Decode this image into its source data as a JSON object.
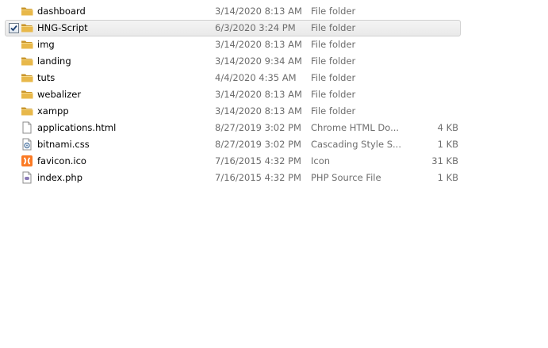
{
  "files": [
    {
      "name": "dashboard",
      "date": "3/14/2020 8:13 AM",
      "type": "File folder",
      "size": "",
      "icon": "folder-icon",
      "selected": false
    },
    {
      "name": "HNG-Script",
      "date": "6/3/2020 3:24 PM",
      "type": "File folder",
      "size": "",
      "icon": "folder-icon",
      "selected": true
    },
    {
      "name": "img",
      "date": "3/14/2020 8:13 AM",
      "type": "File folder",
      "size": "",
      "icon": "folder-icon",
      "selected": false
    },
    {
      "name": "landing",
      "date": "3/14/2020 9:34 AM",
      "type": "File folder",
      "size": "",
      "icon": "folder-icon",
      "selected": false
    },
    {
      "name": "tuts",
      "date": "4/4/2020 4:35 AM",
      "type": "File folder",
      "size": "",
      "icon": "folder-icon",
      "selected": false
    },
    {
      "name": "webalizer",
      "date": "3/14/2020 8:13 AM",
      "type": "File folder",
      "size": "",
      "icon": "folder-icon",
      "selected": false
    },
    {
      "name": "xampp",
      "date": "3/14/2020 8:13 AM",
      "type": "File folder",
      "size": "",
      "icon": "folder-icon",
      "selected": false
    },
    {
      "name": "applications.html",
      "date": "8/27/2019 3:02 PM",
      "type": "Chrome HTML Do...",
      "size": "4 KB",
      "icon": "html-file-icon",
      "selected": false
    },
    {
      "name": "bitnami.css",
      "date": "8/27/2019 3:02 PM",
      "type": "Cascading Style S...",
      "size": "1 KB",
      "icon": "css-file-icon",
      "selected": false
    },
    {
      "name": "favicon.ico",
      "date": "7/16/2015 4:32 PM",
      "type": "Icon",
      "size": "31 KB",
      "icon": "xampp-icon",
      "selected": false
    },
    {
      "name": "index.php",
      "date": "7/16/2015 4:32 PM",
      "type": "PHP Source File",
      "size": "1 KB",
      "icon": "php-file-icon",
      "selected": false
    }
  ],
  "colors": {
    "folder": "#e8b84a",
    "folder_dark": "#c9952a",
    "xampp": "#fb7a24",
    "php": "#8a7ab8",
    "secondary_text": "#6d6d6d",
    "selection_border": "#d0d0d0"
  }
}
